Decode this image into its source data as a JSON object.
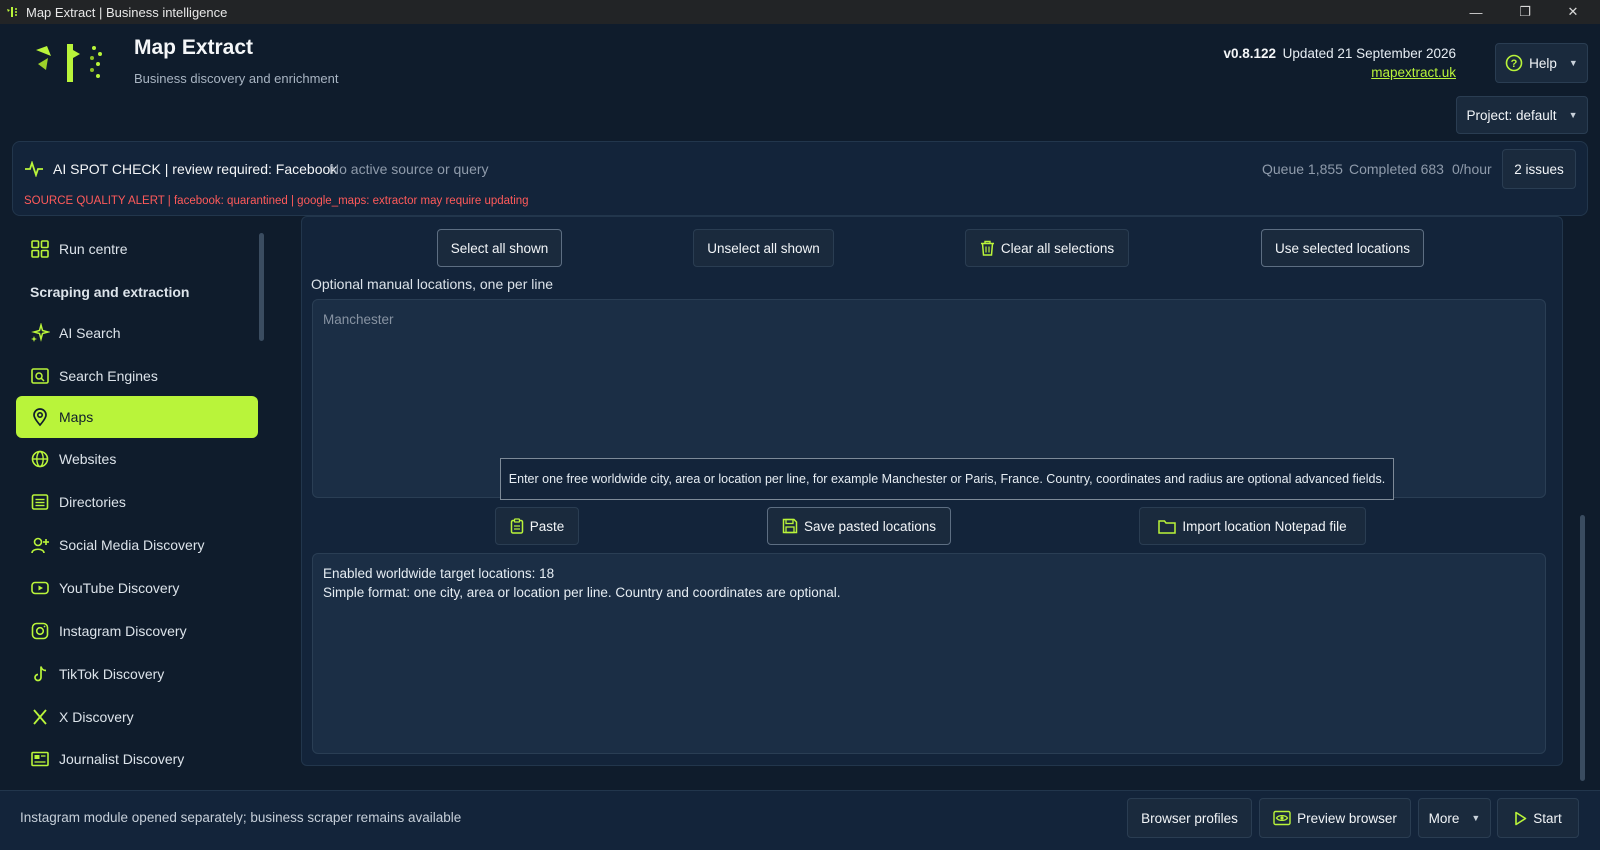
{
  "window": {
    "title": "Map Extract | Business intelligence",
    "minimize_icon": "minimize-icon",
    "maximize_icon": "restore-icon",
    "close_icon": "close-icon"
  },
  "header": {
    "app_name": "Map Extract",
    "subtitle": "Business discovery and enrichment",
    "version": "v0.8.122",
    "updated": "Updated 21 September 2026",
    "link": "mapextract.uk",
    "help_label": "Help",
    "project_label": "Project: default"
  },
  "status": {
    "spot_check": "AI SPOT CHECK | review required: Facebook",
    "source_info": "No active source or query",
    "alert": "SOURCE QUALITY ALERT | facebook: quarantined | google_maps: extractor may require updating",
    "queue": "Queue 1,855",
    "completed": "Completed 683",
    "rate": "0/hour",
    "issues_label": "2 issues"
  },
  "sidebar": {
    "run_centre": "Run centre",
    "section_title": "Scraping and extraction",
    "items": [
      {
        "label": "AI Search",
        "icon": "sparkle-icon"
      },
      {
        "label": "Search Engines",
        "icon": "search-engine-icon"
      },
      {
        "label": "Maps",
        "icon": "map-pin-icon",
        "active": true
      },
      {
        "label": "Websites",
        "icon": "globe-icon"
      },
      {
        "label": "Directories",
        "icon": "list-icon"
      },
      {
        "label": "Social Media Discovery",
        "icon": "user-plus-icon"
      },
      {
        "label": "YouTube Discovery",
        "icon": "youtube-icon"
      },
      {
        "label": "Instagram Discovery",
        "icon": "instagram-icon"
      },
      {
        "label": "TikTok Discovery",
        "icon": "tiktok-icon"
      },
      {
        "label": "X Discovery",
        "icon": "x-icon"
      },
      {
        "label": "Journalist Discovery",
        "icon": "newspaper-icon"
      }
    ]
  },
  "main": {
    "buttons": {
      "select_all": "Select all shown",
      "unselect_all": "Unselect all shown",
      "clear_all": "Clear all selections",
      "use_selected": "Use selected locations"
    },
    "manual_label": "Optional manual locations, one per line",
    "manual_placeholder": "Manchester",
    "hint": "Enter one free worldwide city, area or location per line, for example Manchester or Paris, France. Country, coordinates and radius are optional advanced fields.",
    "paste": "Paste",
    "save_pasted": "Save pasted locations",
    "import_file": "Import location Notepad file",
    "info_line1": "Enabled worldwide target locations: 18",
    "info_line2": "Simple format: one city, area or location per line. Country and coordinates are optional."
  },
  "bottom": {
    "message": "Instagram module opened separately; business scraper remains available",
    "browser_profiles": "Browser profiles",
    "preview_browser": "Preview browser",
    "more": "More",
    "start": "Start"
  },
  "colors": {
    "accent": "#b9f43a",
    "background": "#0f1c2c",
    "panel": "#13243a",
    "alert": "#ff5a5a"
  }
}
